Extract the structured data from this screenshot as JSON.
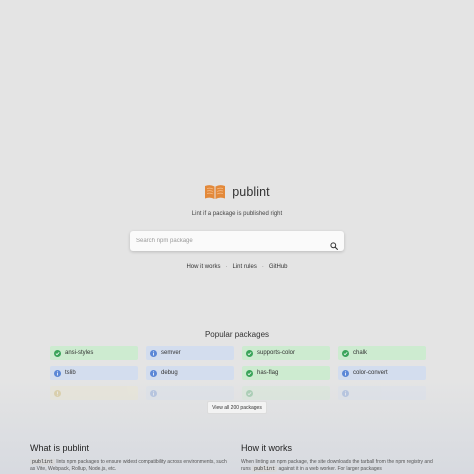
{
  "brand": {
    "name": "publint",
    "tagline": "Lint if a package is published right"
  },
  "search": {
    "placeholder": "Search npm package"
  },
  "nav": {
    "how_it_works": "How it works",
    "lint_rules": "Lint rules",
    "github": "GitHub",
    "separator": "·"
  },
  "popular": {
    "title": "Popular packages",
    "packages": [
      {
        "name": "ansi-styles",
        "status": "pass",
        "color": "#cdebd0"
      },
      {
        "name": "semver",
        "status": "info",
        "color": "#d3ddee"
      },
      {
        "name": "supports-color",
        "status": "pass",
        "color": "#cdebd0"
      },
      {
        "name": "chalk",
        "status": "pass",
        "color": "#cdebd0"
      },
      {
        "name": "tslib",
        "status": "info",
        "color": "#d3ddee"
      },
      {
        "name": "debug",
        "status": "info",
        "color": "#d3ddee"
      },
      {
        "name": "has-flag",
        "status": "pass",
        "color": "#cdebd0"
      },
      {
        "name": "color-convert",
        "status": "info",
        "color": "#d3ddee"
      },
      {
        "name": "",
        "status": "warn",
        "color": "#ece6c8"
      },
      {
        "name": "",
        "status": "info",
        "color": "#d3ddee"
      },
      {
        "name": "",
        "status": "pass",
        "color": "#cdebd0"
      },
      {
        "name": "",
        "status": "info",
        "color": "#d3ddee"
      }
    ],
    "view_all": "View all 200 packages"
  },
  "what": {
    "title": "What is publint",
    "code": "publint",
    "text": " lints npm packages to ensure widest compatibility across environments, such as Vite, Webpack, Rollup, Node.js, etc."
  },
  "how": {
    "title": "How it works",
    "text_before": "When linting an npm package, the site downloads the tarball from the npm registry and runs ",
    "code": "publint",
    "text_after": " against it in a web worker. For larger packages"
  },
  "colors": {
    "pass": "#3aa45a",
    "info": "#5b87d6",
    "warn": "#c9a83a",
    "logo": "#e3893a"
  }
}
